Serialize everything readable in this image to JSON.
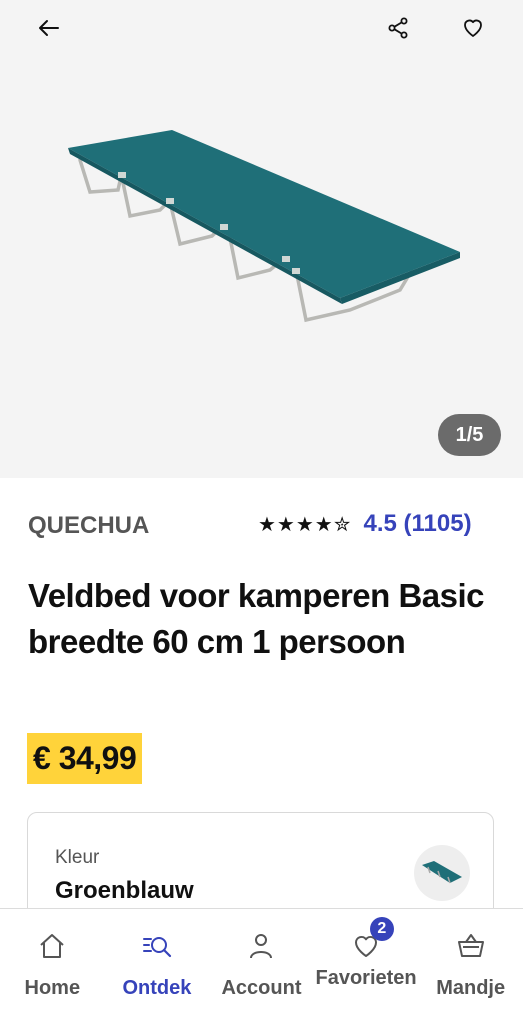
{
  "gallery": {
    "counter": "1/5"
  },
  "product": {
    "brand": "QUECHUA",
    "stars": "★★★★✮",
    "rating": "4.5 (1105)",
    "title": "Veldbed voor kamperen Basic breedte 60 cm 1 persoon",
    "price": "€ 34,99",
    "variant": {
      "label": "Kleur",
      "value": "Groenblauw"
    }
  },
  "nav": {
    "items": [
      {
        "label": "Home"
      },
      {
        "label": "Ontdek"
      },
      {
        "label": "Account"
      },
      {
        "label": "Favorieten",
        "badge": "2"
      },
      {
        "label": "Mandje"
      }
    ]
  },
  "colors": {
    "accent": "#3643ba",
    "price_bg": "#ffd33a",
    "product_teal": "#1f6f78"
  }
}
